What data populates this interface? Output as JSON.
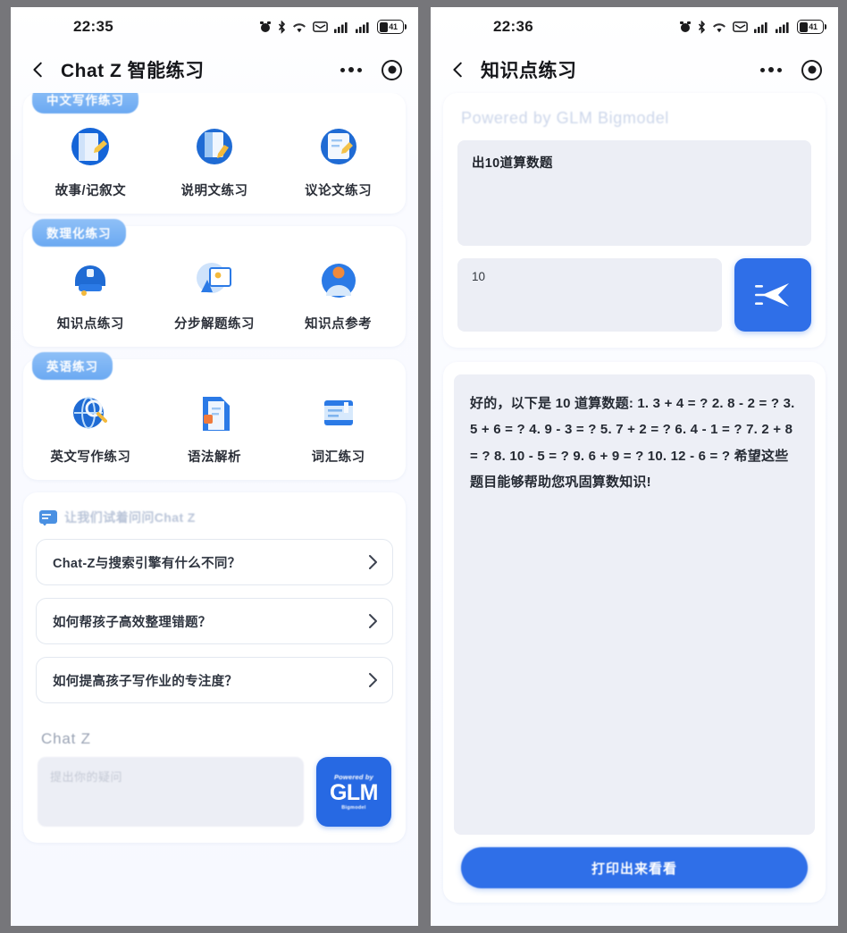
{
  "left": {
    "status": {
      "time": "22:35",
      "battery_level": "41",
      "icons": [
        "alarm-icon",
        "bluetooth-icon",
        "wifi-icon",
        "mail-icon",
        "signal-icon",
        "signal-icon",
        "battery-icon"
      ]
    },
    "nav": {
      "back": "‹",
      "title": "Chat Z 智能练习",
      "more": "more-icon",
      "target": "target-icon"
    },
    "groups": [
      {
        "tag": "中文写作练习",
        "items": [
          {
            "label": "故事/记叙文",
            "icon": "document-pen-icon"
          },
          {
            "label": "说明文练习",
            "icon": "book-pencil-icon"
          },
          {
            "label": "议论文练习",
            "icon": "notepad-icon"
          }
        ]
      },
      {
        "tag": "数理化练习",
        "items": [
          {
            "label": "知识点练习",
            "icon": "graduation-cap-icon"
          },
          {
            "label": "分步解题练习",
            "icon": "whiteboard-icon"
          },
          {
            "label": "知识点参考",
            "icon": "student-icon"
          }
        ]
      },
      {
        "tag": "英语练习",
        "items": [
          {
            "label": "英文写作练习",
            "icon": "globe-search-icon"
          },
          {
            "label": "语法解析",
            "icon": "documents-icon"
          },
          {
            "label": "词汇练习",
            "icon": "card-stack-icon"
          }
        ]
      }
    ],
    "suggestions": {
      "heading": "让我们试着问问Chat Z",
      "heading_icon": "chat-bubble-icon",
      "items": [
        "Chat-Z与搜索引擎有什么不同？",
        "如何帮孩子高效整理错题？",
        "如何提高孩子写作业的专注度？"
      ],
      "chevron": "chevron-right-icon"
    },
    "compose": {
      "label": "Chat Z",
      "placeholder": "提出你的疑问",
      "value": "",
      "button": {
        "line1": "Powered by",
        "line2": "GLM",
        "line3": "Bigmodel"
      }
    }
  },
  "right": {
    "status": {
      "time": "22:36",
      "battery_level": "41",
      "icons": [
        "alarm-icon",
        "bluetooth-icon",
        "wifi-icon",
        "mail-icon",
        "signal-icon",
        "signal-icon",
        "battery-icon"
      ]
    },
    "nav": {
      "back": "‹",
      "title": "知识点练习",
      "more": "more-icon",
      "target": "target-icon"
    },
    "powered_by": "Powered by GLM Bigmodel",
    "prompt_value": "出10道算数题",
    "count_value": "10",
    "send_icon": "send-plane-icon",
    "answer": "好的，以下是 10 道算数题: 1. 3 + 4 = ? 2. 8 - 2 = ? 3. 5 + 6 = ? 4. 9 - 3 = ? 5. 7 + 2 = ? 6. 4 - 1 = ? 7. 2 + 8 = ? 8. 10 - 5 = ? 9. 6 + 9 = ? 10. 12 - 6 = ? 希望这些题目能够帮助您巩固算数知识!",
    "print_button": "打印出来看看"
  },
  "colors": {
    "accent_blue": "#2f6fe8",
    "tag_blue": "#6ba9f2",
    "frame_gray": "#76767a",
    "field_gray": "#eceef5"
  }
}
